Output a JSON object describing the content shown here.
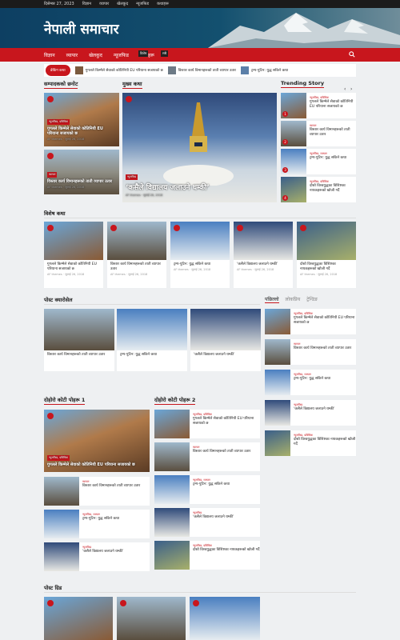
{
  "top_bar": {
    "date": "दिसेम्बर 27, 2023",
    "links": [
      "विज्ञान",
      "व्यापार",
      "खेलकुद",
      "न्यूजफिड",
      "कथाहरू"
    ]
  },
  "header": {
    "site_title": "नेपाली समाचार"
  },
  "nav": {
    "items": [
      "विज्ञान",
      "व्यापार",
      "खेलकुद",
      "न्यूजफिड",
      "कथाहरू"
    ],
    "badge": "विशेष",
    "badge2": "सबै",
    "search_icon": "search-icon"
  },
  "ticker": {
    "label": "ब्रेकिंग कथा",
    "items": [
      "गुगलले किम्मेले सेवाको कोतिनियी EU परियाना सजायको छ",
      "विस्तार कार्य विमानहरूको ताती व्यापार उतार",
      "ट्रम्प-पुटिन: युद्ध सकिने कथा"
    ]
  },
  "sections": {
    "editor_picks": "सम्पादकको छनोट",
    "main_story": "मुख्य कथा",
    "trending": "Trending Story",
    "special": "विशेष कथा",
    "carousel": "पोस्ट क्यारोसेल",
    "double1": "दोहोरो कोटी पोहरू 1",
    "double2": "दोहोरो कोटी पोहरू 2",
    "grid": "पोस्ट ग्रिड"
  },
  "side_tabs": [
    "पछिल्लो",
    "लोकप्रिय",
    "ट्रेन्डिङ"
  ],
  "headlines": {
    "google": "गुगलले किम्मेले सेवाको कोतिनियी EU परियाना सजायको छ",
    "plane": "विस्तार कार्य विमानहरूको ताती व्यापार उतार",
    "trump": "ट्रम्प-पुटिन: युद्ध सकिने कथा",
    "school": "‘कसैले विद्यालय जलाउने धम्की’",
    "doctor": "दोस्रो विश्वयुद्धका विशिष्टका नायकहरूको खोजी गर्दै"
  },
  "cats": {
    "tech": "न्यूजफिड, प्रविधिक",
    "biz": "व्यापार",
    "news": "न्यूजफिड",
    "ns": "न्यूजफिड, व्यापार"
  },
  "meta": {
    "author": "AF themes",
    "date": "जुलाई 26, 2018",
    "comments": "0"
  },
  "trending_numbers": [
    "1",
    "2",
    "3",
    "4"
  ]
}
